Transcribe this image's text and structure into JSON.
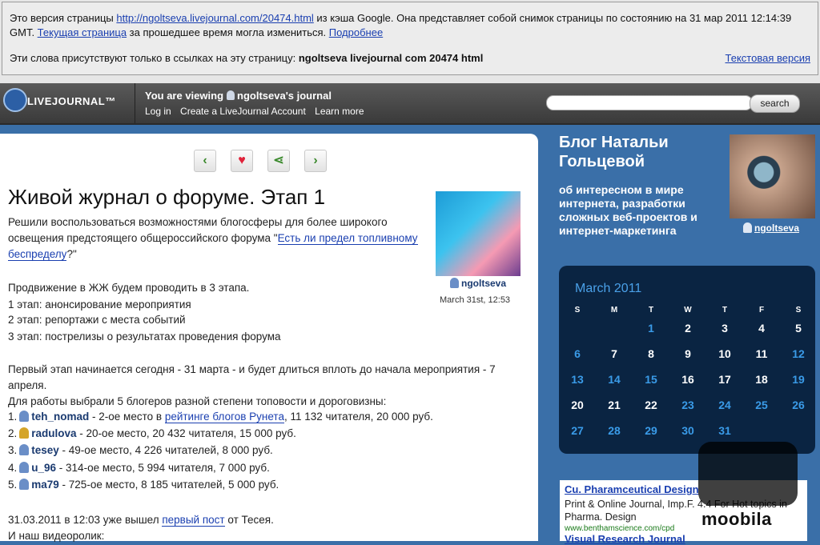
{
  "cache": {
    "intro": "Это версия страницы ",
    "url": "http://ngoltseva.livejournal.com/20474.html",
    "mid": " из кэша Google. Она представляет собой снимок страницы по состоянию на 31 мар 2011 12:14:39 GMT. ",
    "current_link": "Текущая страница",
    "after_current": " за прошедшее время могла измениться. ",
    "more_link": "Подробнее",
    "words_label": "Эти слова присутствуют только в ссылках на эту страницу: ",
    "words": "ngoltseva livejournal com 20474 html",
    "text_version": "Текстовая версия"
  },
  "lj_header": {
    "logo": "LIVEJOURNAL™",
    "viewing_prefix": "You are viewing",
    "viewing_user": "ngoltseva's journal",
    "links": [
      "Log in",
      "Create a LiveJournal Account",
      "Learn more"
    ],
    "search_button": "search"
  },
  "post": {
    "nav": [
      "‹",
      "♥",
      "⋖",
      "›"
    ],
    "title": "Живой журнал о форуме. Этап 1",
    "intro_a": "Решили воспользоваться возможностями блогосферы для более широкого освещения предстоящего общероссийского форума \"",
    "intro_link": "Есть ли предел топливному беспределу",
    "intro_b": "?\"",
    "stages_intro": "Продвижение в ЖЖ будем проводить в 3 этапа.",
    "stage1": "1 этап: анонсирование мероприятия",
    "stage2": "2 этап: репортажи с места событий",
    "stage3": "3 этап: пострелизы о результатах проведения форума",
    "first_stage": "Первый этап начинается сегодня - 31 марта - и будет длиться вплоть до начала мероприятия - 7 апреля.",
    "bloggers_intro": "Для работы выбрали 5 блогеров разной степени топовости и дороговизны:",
    "bloggers": [
      {
        "num": "1.",
        "name": "teh_nomad",
        "pre": " - 2-ое место в ",
        "link": "рейтинге блогов Рунета",
        "post": ", 11 132 читателя, 20 000 руб."
      },
      {
        "num": "2.",
        "name": "radulova",
        "pre": " - 20-ое место, 20 432 читателя, 15 000 руб.",
        "link": "",
        "post": ""
      },
      {
        "num": "3.",
        "name": "tesey",
        "pre": " - 49-ое место, 4 226 читателей, 8 000 руб.",
        "link": "",
        "post": ""
      },
      {
        "num": "4.",
        "name": "u_96",
        "pre": " - 314-ое место, 5 994 читателя,  7 000 руб.",
        "link": "",
        "post": ""
      },
      {
        "num": "5.",
        "name": "ma79",
        "pre": " -  725-ое место, 8 185 читателей, 5 000 руб.",
        "link": "",
        "post": ""
      }
    ],
    "update_a": "31.03.2011 в 12:03 уже вышел ",
    "update_link": "первый пост",
    "update_b": " от Тесея.",
    "video": "И наш видеоролик:",
    "author": "ngoltseva",
    "date": "March 31st, 12:53"
  },
  "sidebar": {
    "blog_title": "Блог Натальи Гольцевой",
    "subtitle": "об интересном в мире интернета, разработки сложных веб-проектов и интернет-маркетинга",
    "avatar_user": "ngoltseva"
  },
  "calendar": {
    "title": "March 2011",
    "dow": [
      "S",
      "M",
      "T",
      "W",
      "T",
      "F",
      "S"
    ],
    "weeks": [
      [
        "",
        "",
        "1",
        "2",
        "3",
        "4",
        "5"
      ],
      [
        "6",
        "7",
        "8",
        "9",
        "10",
        "11",
        "12"
      ],
      [
        "13",
        "14",
        "15",
        "16",
        "17",
        "18",
        "19"
      ],
      [
        "20",
        "21",
        "22",
        "23",
        "24",
        "25",
        "26"
      ],
      [
        "27",
        "28",
        "29",
        "30",
        "31",
        "",
        ""
      ]
    ],
    "linked_days": [
      "1",
      "6",
      "12",
      "13",
      "14",
      "15",
      "19",
      "23",
      "24",
      "25",
      "26",
      "27",
      "28",
      "29",
      "30",
      "31"
    ],
    "link_color": "#3a9be8",
    "plain_color": "#ffffff"
  },
  "ad": {
    "title": "Cu. Pharamceutical Design",
    "desc": "Print & Online Journal, Imp.F. 4.4 For Hot topics in Pharma. Design",
    "url": "www.benthamscience.com/cpd",
    "title2": "Visual Research Journal"
  },
  "watermark": "moobila"
}
